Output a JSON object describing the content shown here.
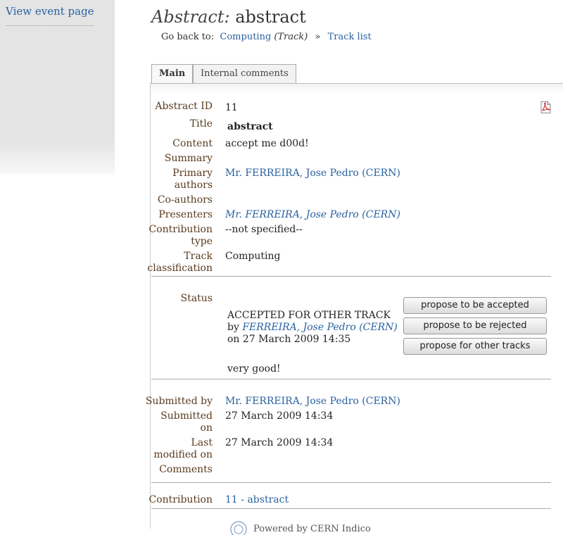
{
  "sidebar": {
    "view_event": "View event page"
  },
  "header": {
    "title_prefix": "Abstract:",
    "title": "abstract",
    "goback_label": "Go back to:",
    "track_link": "Computing",
    "track_tag": "(Track)",
    "separator": "»",
    "tracklist_link": "Track list"
  },
  "tabs": [
    {
      "label": "Main"
    },
    {
      "label": "Internal comments"
    }
  ],
  "fields": {
    "abstract_id": {
      "label": "Abstract ID",
      "value": "11"
    },
    "title": {
      "label": "Title",
      "value": "abstract"
    },
    "content": {
      "label": "Content",
      "value": "accept me d00d!"
    },
    "summary": {
      "label": "Summary",
      "value": ""
    },
    "primary_authors": {
      "label1": "Primary",
      "label2": "authors",
      "value": "Mr. FERREIRA, Jose Pedro (CERN)"
    },
    "co_authors": {
      "label": "Co-authors",
      "value": ""
    },
    "presenters": {
      "label": "Presenters",
      "value": "Mr. FERREIRA, Jose Pedro (CERN)"
    },
    "contribution_type": {
      "label1": "Contribution",
      "label2": "type",
      "value": "--not specified--"
    },
    "track": {
      "label1": "Track",
      "label2": "classification",
      "value": "Computing"
    }
  },
  "status": {
    "label": "Status",
    "state": "ACCEPTED FOR OTHER TRACK",
    "by_prefix": "by",
    "by_user": "FERREIRA, Jose Pedro (CERN)",
    "on_line": "on 27 March 2009 14:35",
    "comment": "very good!",
    "buttons": {
      "accept": "propose to be accepted",
      "reject": "propose to be rejected",
      "other": "propose for other tracks"
    }
  },
  "meta": {
    "submitted_by": {
      "label": "Submitted by",
      "value": "Mr. FERREIRA, Jose Pedro (CERN)"
    },
    "submitted_on": {
      "label1": "Submitted",
      "label2": "on",
      "value": "27 March 2009 14:34"
    },
    "modified_on": {
      "label1": "Last",
      "label2": "modified on",
      "value": "27 March 2009 14:34"
    },
    "comments": {
      "label": "Comments",
      "value": ""
    }
  },
  "contribution": {
    "label": "Contribution",
    "value": "11 - abstract"
  },
  "footer": {
    "powered": "Powered by CERN Indico"
  },
  "icons": {
    "pdf": "pdf-icon",
    "cern_logo": "cern-logo-icon"
  },
  "colors": {
    "link": "#2a62a0",
    "label": "#5a3a1e"
  }
}
